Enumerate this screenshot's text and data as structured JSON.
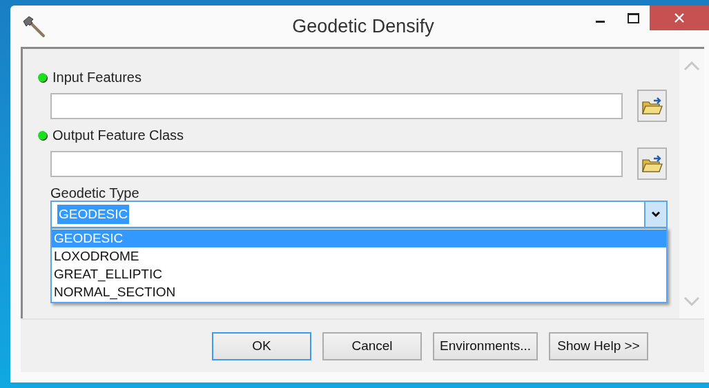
{
  "window": {
    "title": "Geodetic Densify"
  },
  "parameters": [
    {
      "label": "Input Features",
      "required": true
    },
    {
      "label": "Output Feature Class",
      "required": true
    }
  ],
  "geodetic_type": {
    "label": "Geodetic Type",
    "value": "GEODESIC",
    "expanded": true,
    "options": [
      {
        "label": "GEODESIC",
        "selected": true
      },
      {
        "label": "LOXODROME",
        "selected": false
      },
      {
        "label": "GREAT_ELLIPTIC",
        "selected": false
      },
      {
        "label": "NORMAL_SECTION",
        "selected": false
      }
    ]
  },
  "buttons": [
    {
      "label": "OK",
      "default": true
    },
    {
      "label": "Cancel",
      "default": false
    },
    {
      "label": "Environments...",
      "default": false
    },
    {
      "label": "Show Help >>",
      "default": false
    }
  ]
}
